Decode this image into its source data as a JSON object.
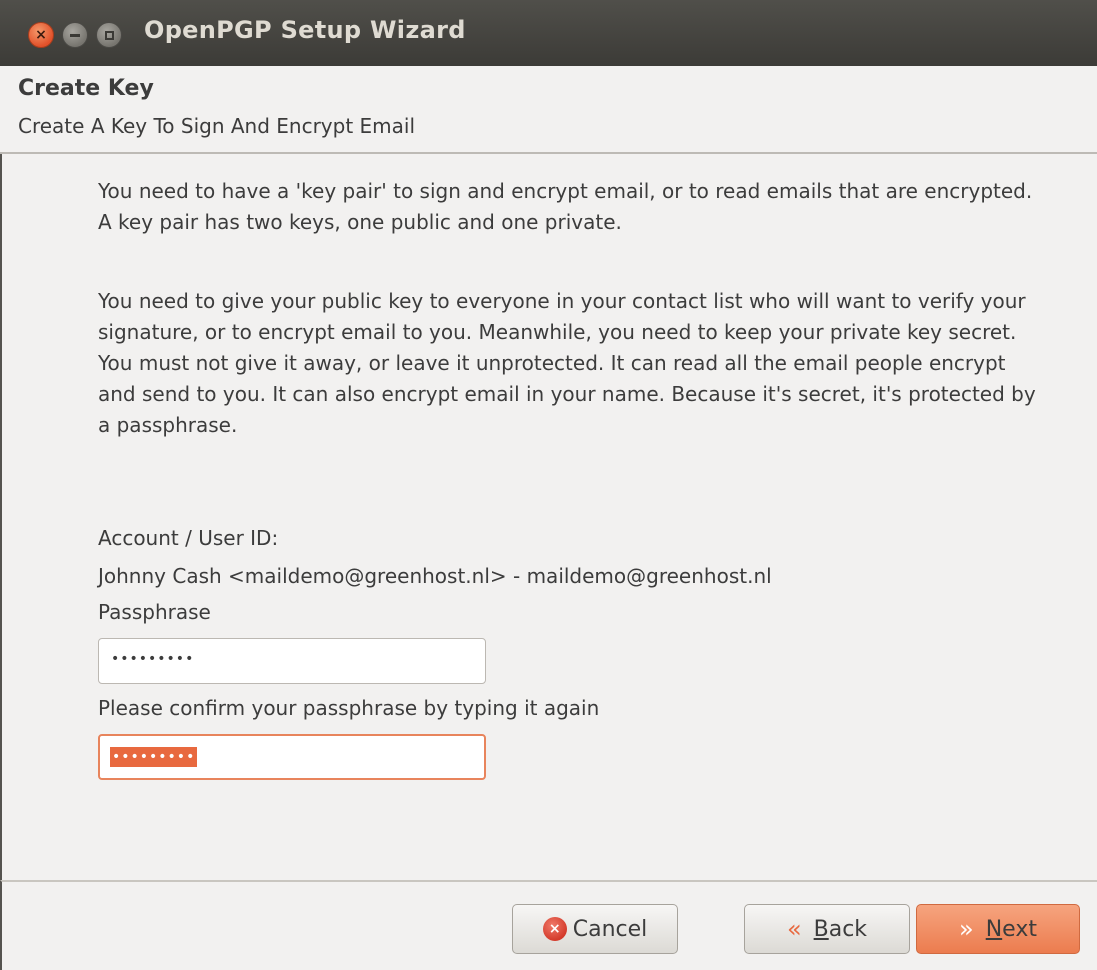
{
  "window": {
    "title": "OpenPGP Setup Wizard",
    "close_glyph": "×",
    "controls": [
      "close-icon",
      "minimize-icon",
      "maximize-icon"
    ]
  },
  "header": {
    "title": "Create Key",
    "subtitle": "Create A Key To Sign And Encrypt Email"
  },
  "content": {
    "paragraph1": "You need to have a 'key pair' to sign and encrypt email, or to read emails that are encrypted. A key pair has two keys, one public and one private.",
    "paragraph2": "You need to give your public key to everyone in your contact list who will want to verify your signature, or to encrypt email to you. Meanwhile, you need to keep your private key secret. You must not give it away, or leave it unprotected. It can read all the email people encrypt and send to you. It can also encrypt email in your name. Because it's secret, it's protected by a passphrase.",
    "account_label": "Account / User ID:",
    "account_value": "Johnny Cash <maildemo@greenhost.nl> - maildemo@greenhost.nl",
    "passphrase_label": "Passphrase",
    "passphrase_value": "•••••••••",
    "confirm_label": "Please confirm your passphrase by typing it again",
    "confirm_value": "•••••••••"
  },
  "buttons": {
    "cancel_label": "Cancel",
    "back_prefix": "",
    "back_mnemonic": "B",
    "back_rest": "ack",
    "next_mnemonic": "N",
    "next_rest": "ext",
    "cancel_icon_glyph": "×",
    "back_chevron": "«",
    "next_chevron": "»"
  },
  "colors": {
    "accent": "#e8693f",
    "titlebar": "#3c3b37",
    "background": "#f2f1f0"
  }
}
